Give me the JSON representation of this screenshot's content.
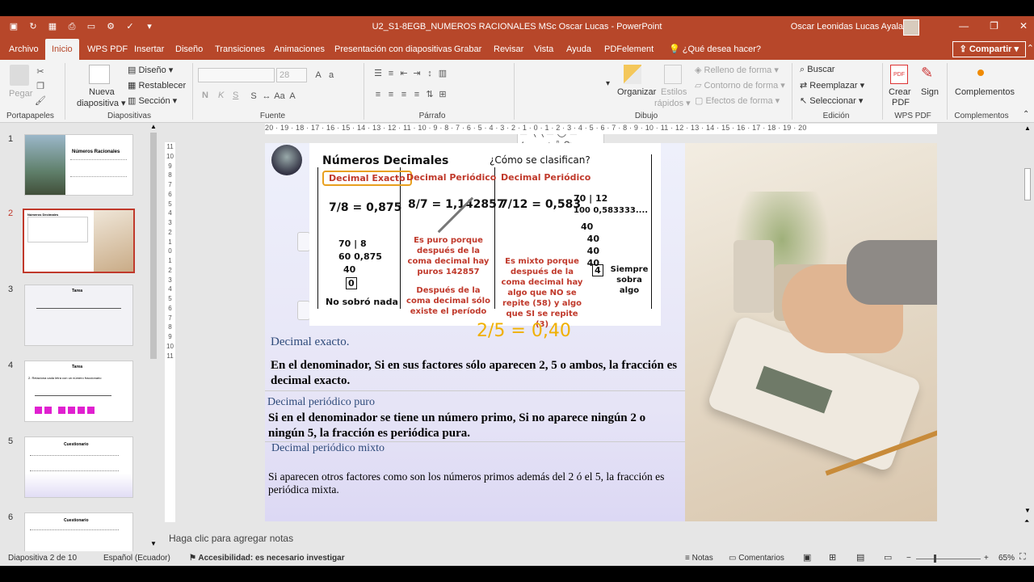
{
  "window": {
    "doc_title": "U2_S1-8EGB_NUMEROS RACIONALES MSc Oscar Lucas  -  PowerPoint",
    "user_name": "Oscar Leonidas Lucas Ayala",
    "minimize": "—",
    "restore": "❐",
    "close": "✕"
  },
  "tabs": [
    {
      "label": "Archivo"
    },
    {
      "label": "Inicio"
    },
    {
      "label": "WPS PDF"
    },
    {
      "label": "Insertar"
    },
    {
      "label": "Diseño"
    },
    {
      "label": "Transiciones"
    },
    {
      "label": "Animaciones"
    },
    {
      "label": "Presentación con diapositivas"
    },
    {
      "label": "Grabar"
    },
    {
      "label": "Revisar"
    },
    {
      "label": "Vista"
    },
    {
      "label": "Ayuda"
    },
    {
      "label": "PDFelement"
    }
  ],
  "search": {
    "label": "¿Qué desea hacer?"
  },
  "share": {
    "label": "Compartir"
  },
  "ribbon": {
    "paste": "Pegar",
    "new_slide_1": "Nueva",
    "new_slide_2": "diapositiva",
    "layout": "Diseño",
    "reset": "Restablecer",
    "section": "Sección",
    "font_size": "28",
    "bold": "N",
    "italic": "K",
    "underline": "S",
    "arrange": "Organizar",
    "quick_styles_1": "Estilos",
    "quick_styles_2": "rápidos",
    "shape_fill": "Relleno de forma",
    "shape_outline": "Contorno de forma",
    "shape_effects": "Efectos de forma",
    "find": "Buscar",
    "replace": "Reemplazar",
    "select": "Seleccionar",
    "create_pdf_1": "Crear",
    "create_pdf_2": "PDF",
    "sign": "Sign",
    "addins": "Complementos",
    "groups": {
      "clipboard": "Portapapeles",
      "slides": "Diapositivas",
      "font": "Fuente",
      "paragraph": "Párrafo",
      "drawing": "Dibujo",
      "editing": "Edición",
      "wps": "WPS PDF",
      "addins": "Complementos"
    }
  },
  "thumbnails": [
    {
      "num": "1",
      "title": "Números Racionales"
    },
    {
      "num": "2",
      "title": "Números Decimales"
    },
    {
      "num": "3",
      "title": "Tarea"
    },
    {
      "num": "4",
      "title": "Tarea",
      "line": "2.   Relaciona cada letra con un número fraccionario"
    },
    {
      "num": "5",
      "title": "Cuestionario"
    },
    {
      "num": "6",
      "title": "Cuestionario"
    }
  ],
  "ruler_h": "20 · 19 · 18 · 17 · 16 · 15 · 14 · 13 · 12 · 11 · 10 · 9 · 8 · 7 · 6 · 5 · 4 · 3 · 2 · 1 · 0 · 1 · 2 · 3 · 4 · 5 · 6 · 7 · 8 · 9 · 10 · 11 · 12 · 13 · 14 · 15 · 16 · 17 · 18 · 19 · 20",
  "ruler_v": [
    "11",
    "10",
    "9",
    "8",
    "7",
    "6",
    "5",
    "4",
    "3",
    "2",
    "1",
    "0",
    "1",
    "2",
    "3",
    "4",
    "5",
    "6",
    "7",
    "8",
    "9",
    "10",
    "11"
  ],
  "slide": {
    "table": {
      "heading": "Números Decimales",
      "question": "¿Cómo se clasifican?",
      "col1": "Decimal Exacto",
      "col2": "Decimal Periódico",
      "col3": "Decimal Periódico",
      "ex1": "7/8 = 0,875",
      "ex1_div": "70 | 8",
      "ex1_div2": "60   0,875",
      "ex1_div3": "40",
      "ex1_rem": "0",
      "ex1_note": "No sobró nada",
      "ex2": "8/7 = 1,142857",
      "ex2_note1": "Es puro porque después de la coma decimal hay puros 142857",
      "ex2_note2": "Después de la coma decimal sólo existe el período",
      "ex3": "7/12 = 0,583",
      "ex3_div": "70 | 12",
      "ex3_div2": "100   0,583333....",
      "ex3_div3": "40",
      "ex3_rem": "4",
      "ex3_side": "Siempre sobra algo",
      "ex3_note": "Es mixto porque después de la coma decimal hay algo que NO se repite (58) y algo que SI se repite (3)"
    },
    "annotation": "2/5 = 0,40",
    "h1": "Decimal exacto.",
    "p1": "En el denominador, Si en sus factores sólo aparecen 2, 5 o ambos, la fracción es decimal exacto.",
    "h2": "Decimal periódico puro",
    "p2": "Si en el denominador se tiene un número primo, Si no aparece ningún 2 o ningún 5, la fracción es periódica pura.",
    "h3": "Decimal periódico mixto",
    "p3": "Si aparecen otros factores como son los números primos además del 2 ó el 5, la fracción es periódica mixta."
  },
  "notes_placeholder": "Haga clic para agregar notas",
  "status": {
    "slide_of": "Diapositiva 2 de 10",
    "language": "Español (Ecuador)",
    "accessibility": "Accesibilidad: es necesario investigar",
    "notes": "Notas",
    "comments": "Comentarios",
    "zoom": "65%",
    "zoom_minus": "−",
    "zoom_plus": "+"
  },
  "colors": {
    "accent": "#b7472a",
    "selected_thumb": "#c0392b",
    "table_header": "#c0392b",
    "exact_box": "#e8a020",
    "annotation": "#f0b000"
  }
}
